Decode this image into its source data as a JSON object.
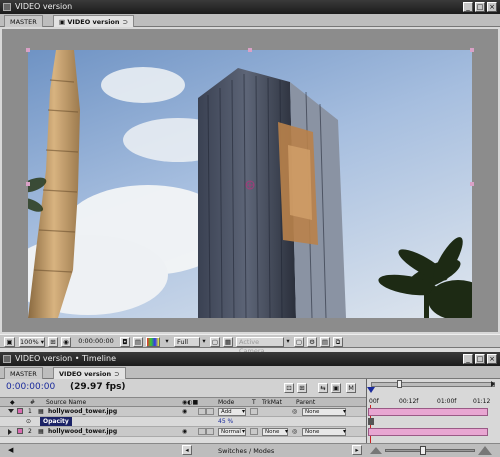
{
  "comp_window": {
    "title": "VIDEO version",
    "tabs": [
      {
        "label": "MASTER"
      },
      {
        "label": "VIDEO version"
      }
    ],
    "toolbar": {
      "zoom": "100%",
      "timecode": "0:00:00:00",
      "resolution": "Full",
      "camera": "Active Camera"
    }
  },
  "timeline": {
    "title": "VIDEO version • Timeline",
    "tabs": [
      {
        "label": "MASTER"
      },
      {
        "label": "VIDEO version"
      }
    ],
    "timecode": "0:00:00:00",
    "fps": "(29.97 fps)",
    "columns": {
      "source_name": "Source Name",
      "mode": "Mode",
      "t": "T",
      "trkmat": "TrkMat",
      "parent": "Parent"
    },
    "ruler": [
      "00f",
      "00:12f",
      "01:00f",
      "01:12"
    ],
    "layers": [
      {
        "num": "1",
        "name": "hollywood_tower.jpg",
        "mode": "Add",
        "trkmat": "",
        "parent": "None"
      },
      {
        "num": "2",
        "name": "hollywood_tower.jpg",
        "mode": "Normal",
        "trkmat": "None",
        "parent": "None"
      }
    ],
    "property": {
      "name": "Opacity",
      "value": "45 %"
    },
    "footer": "Switches / Modes"
  },
  "colors": {
    "timecode": "#1a2a9c",
    "layer_bar": "#e8a6d2",
    "label_swatch": "#d86ab0"
  }
}
